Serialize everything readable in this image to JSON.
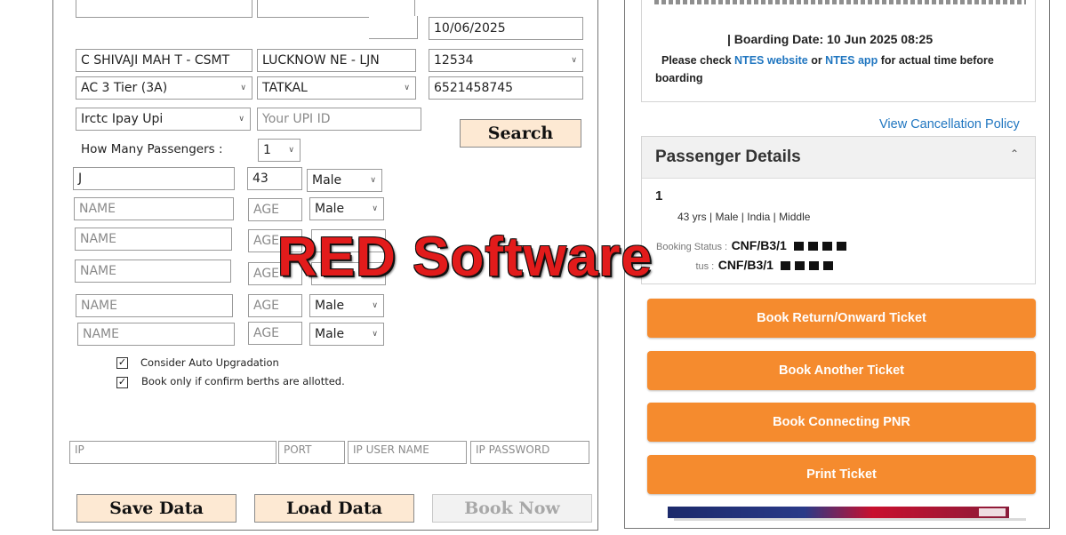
{
  "form": {
    "date": "10/06/2025",
    "from_station": "C SHIVAJI MAH T - CSMT",
    "to_station": "LUCKNOW NE - LJN",
    "train_no": "12534",
    "class": "AC 3 Tier (3A)",
    "quota": "TATKAL",
    "mobile": "6521458745",
    "payment": "Irctc Ipay Upi",
    "upi_placeholder": "Your UPI ID",
    "search_label": "Search",
    "passenger_count_label": "How Many Passengers :",
    "passenger_count": "1",
    "passengers": [
      {
        "name": "J",
        "age": "43",
        "gender": "Male"
      },
      {
        "name": "",
        "age": "",
        "gender": "Male"
      },
      {
        "name": "",
        "age": "",
        "gender": ""
      },
      {
        "name": "",
        "age": "",
        "gender": ""
      },
      {
        "name": "",
        "age": "",
        "gender": "Male"
      },
      {
        "name": "",
        "age": "",
        "gender": "Male"
      }
    ],
    "name_placeholder": "NAME",
    "age_placeholder": "AGE",
    "chk_auto_upgrade": "Consider Auto Upgradation",
    "chk_confirm_berths": "Book only if confirm berths are allotted.",
    "proxy": {
      "ip": "IP",
      "port": "PORT",
      "user": "IP USER NAME",
      "pass": "IP PASSWORD"
    },
    "save_label": "Save Data",
    "load_label": "Load Data",
    "book_label": "Book Now"
  },
  "watermark": "RED Software",
  "booking": {
    "boarding_line": "| Boarding Date: 10 Jun 2025 08:25",
    "ntes_text_1": "Please check",
    "ntes_link_1": "NTES website",
    "ntes_or": "or",
    "ntes_link_2": "NTES app",
    "ntes_text_2": "for actual time before",
    "ntes_text_3": "boarding",
    "cancellation_link": "View Cancellation Policy",
    "passenger_details_title": "Passenger Details",
    "passenger_index": "1",
    "passenger_info": "43 yrs | Male | India | Middle",
    "booking_status_label": "Booking Status :",
    "booking_status_value": "CNF/B3/1",
    "current_status_label": "tus :",
    "current_status_value": "CNF/B3/1",
    "buttons": [
      "Book Return/Onward Ticket",
      "Book Another Ticket",
      "Book Connecting PNR",
      "Print Ticket"
    ]
  },
  "colors": {
    "orange": "#f58b2e",
    "link": "#2076c0",
    "watermark": "#e21b1b",
    "button_bg": "#fde9d3"
  }
}
